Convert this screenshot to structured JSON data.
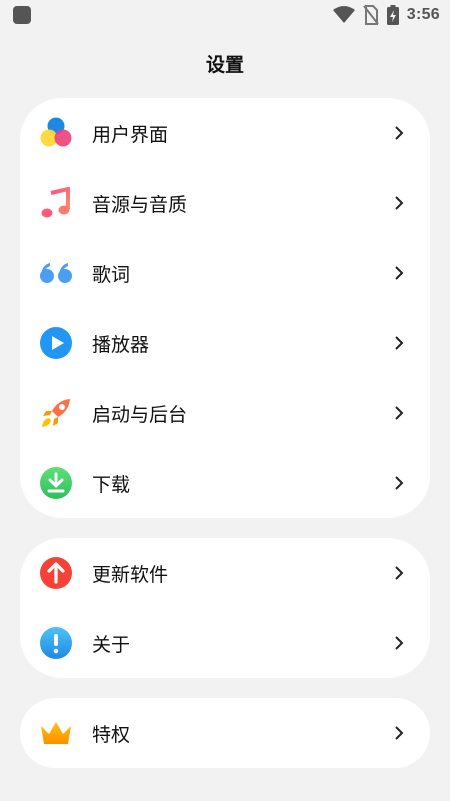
{
  "status_bar": {
    "time": "3:56"
  },
  "page_title": "设置",
  "groups": [
    {
      "items": [
        {
          "label": "用户界面",
          "icon": "palette-icon"
        },
        {
          "label": "音源与音质",
          "icon": "music-note-icon"
        },
        {
          "label": "歌词",
          "icon": "quote-icon"
        },
        {
          "label": "播放器",
          "icon": "play-icon"
        },
        {
          "label": "启动与后台",
          "icon": "rocket-icon"
        },
        {
          "label": "下载",
          "icon": "download-icon"
        }
      ]
    },
    {
      "items": [
        {
          "label": "更新软件",
          "icon": "update-arrow-icon"
        },
        {
          "label": "关于",
          "icon": "info-icon"
        }
      ]
    },
    {
      "items": [
        {
          "label": "特权",
          "icon": "crown-icon"
        }
      ]
    }
  ],
  "colors": {
    "background": "#f2f2f2",
    "card": "#ffffff",
    "play_blue": "#2196f3",
    "update_red": "#f44336",
    "download_green": "#34c759",
    "crown_orange": "#ffa000"
  }
}
